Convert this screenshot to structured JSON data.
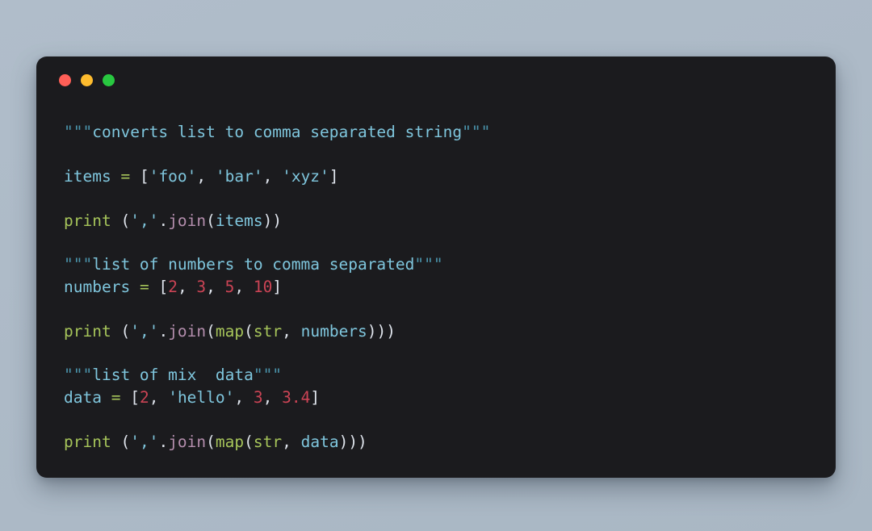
{
  "window": {
    "background_color": "#aebcc9",
    "panel_color": "#1b1b1e",
    "traffic_lights": [
      {
        "name": "close",
        "color": "#ff5f57"
      },
      {
        "name": "minimize",
        "color": "#febc2e"
      },
      {
        "name": "maximize",
        "color": "#28c840"
      }
    ]
  },
  "theme": {
    "plain": "#d8dee9",
    "punctuation": "#dfe4ec",
    "name": "#7fc6dd",
    "string": "#7fc6dd",
    "quote": "#4a93ab",
    "keyword": "#a6c45a",
    "builtin": "#a6c45a",
    "operator": "#a6c45a",
    "method": "#b48ead",
    "number": "#cc4455"
  },
  "code": {
    "language": "python",
    "plain_text": "\"\"\"converts list to comma separated string\"\"\"\n\nitems = ['foo', 'bar', 'xyz']\n\nprint (','.join(items))\n\n\"\"\"list of numbers to comma separated\"\"\"\nnumbers = [2, 3, 5, 10]\n\nprint (','.join(map(str, numbers)))\n\n\"\"\"list of mix  data\"\"\"\ndata = [2, 'hello', 3, 3.4]\n\nprint (','.join(map(str, data)))",
    "lines": [
      {
        "number": 1,
        "tokens": [
          {
            "t": "\"\"\"",
            "c": "quote"
          },
          {
            "t": "converts list to comma separated string",
            "c": "doc"
          },
          {
            "t": "\"\"\"",
            "c": "quote"
          }
        ]
      },
      {
        "number": 2,
        "tokens": []
      },
      {
        "number": 3,
        "tokens": [
          {
            "t": "items",
            "c": "name"
          },
          {
            "t": " ",
            "c": "plain"
          },
          {
            "t": "=",
            "c": "op"
          },
          {
            "t": " ",
            "c": "plain"
          },
          {
            "t": "[",
            "c": "punct"
          },
          {
            "t": "'foo'",
            "c": "string"
          },
          {
            "t": ", ",
            "c": "punct"
          },
          {
            "t": "'bar'",
            "c": "string"
          },
          {
            "t": ", ",
            "c": "punct"
          },
          {
            "t": "'xyz'",
            "c": "string"
          },
          {
            "t": "]",
            "c": "punct"
          }
        ]
      },
      {
        "number": 4,
        "tokens": []
      },
      {
        "number": 5,
        "tokens": [
          {
            "t": "print",
            "c": "kw"
          },
          {
            "t": " ",
            "c": "plain"
          },
          {
            "t": "(",
            "c": "punct"
          },
          {
            "t": "','",
            "c": "string"
          },
          {
            "t": ".",
            "c": "punct"
          },
          {
            "t": "join",
            "c": "method"
          },
          {
            "t": "(",
            "c": "punct"
          },
          {
            "t": "items",
            "c": "name"
          },
          {
            "t": "))",
            "c": "punct"
          }
        ]
      },
      {
        "number": 6,
        "tokens": []
      },
      {
        "number": 7,
        "tokens": [
          {
            "t": "\"\"\"",
            "c": "quote"
          },
          {
            "t": "list of numbers to comma separated",
            "c": "doc"
          },
          {
            "t": "\"\"\"",
            "c": "quote"
          }
        ]
      },
      {
        "number": 8,
        "tokens": [
          {
            "t": "numbers",
            "c": "name"
          },
          {
            "t": " ",
            "c": "plain"
          },
          {
            "t": "=",
            "c": "op"
          },
          {
            "t": " ",
            "c": "plain"
          },
          {
            "t": "[",
            "c": "punct"
          },
          {
            "t": "2",
            "c": "number"
          },
          {
            "t": ", ",
            "c": "punct"
          },
          {
            "t": "3",
            "c": "number"
          },
          {
            "t": ", ",
            "c": "punct"
          },
          {
            "t": "5",
            "c": "number"
          },
          {
            "t": ", ",
            "c": "punct"
          },
          {
            "t": "10",
            "c": "number"
          },
          {
            "t": "]",
            "c": "punct"
          }
        ]
      },
      {
        "number": 9,
        "tokens": []
      },
      {
        "number": 10,
        "tokens": [
          {
            "t": "print",
            "c": "kw"
          },
          {
            "t": " ",
            "c": "plain"
          },
          {
            "t": "(",
            "c": "punct"
          },
          {
            "t": "','",
            "c": "string"
          },
          {
            "t": ".",
            "c": "punct"
          },
          {
            "t": "join",
            "c": "method"
          },
          {
            "t": "(",
            "c": "punct"
          },
          {
            "t": "map",
            "c": "builtin"
          },
          {
            "t": "(",
            "c": "punct"
          },
          {
            "t": "str",
            "c": "builtin"
          },
          {
            "t": ", ",
            "c": "punct"
          },
          {
            "t": "numbers",
            "c": "name"
          },
          {
            "t": ")))",
            "c": "punct"
          }
        ]
      },
      {
        "number": 11,
        "tokens": []
      },
      {
        "number": 12,
        "tokens": [
          {
            "t": "\"\"\"",
            "c": "quote"
          },
          {
            "t": "list of mix  data",
            "c": "doc"
          },
          {
            "t": "\"\"\"",
            "c": "quote"
          }
        ]
      },
      {
        "number": 13,
        "tokens": [
          {
            "t": "data",
            "c": "name"
          },
          {
            "t": " ",
            "c": "plain"
          },
          {
            "t": "=",
            "c": "op"
          },
          {
            "t": " ",
            "c": "plain"
          },
          {
            "t": "[",
            "c": "punct"
          },
          {
            "t": "2",
            "c": "number"
          },
          {
            "t": ", ",
            "c": "punct"
          },
          {
            "t": "'hello'",
            "c": "string"
          },
          {
            "t": ", ",
            "c": "punct"
          },
          {
            "t": "3",
            "c": "number"
          },
          {
            "t": ", ",
            "c": "punct"
          },
          {
            "t": "3.4",
            "c": "number"
          },
          {
            "t": "]",
            "c": "punct"
          }
        ]
      },
      {
        "number": 14,
        "tokens": []
      },
      {
        "number": 15,
        "tokens": [
          {
            "t": "print",
            "c": "kw"
          },
          {
            "t": " ",
            "c": "plain"
          },
          {
            "t": "(",
            "c": "punct"
          },
          {
            "t": "','",
            "c": "string"
          },
          {
            "t": ".",
            "c": "punct"
          },
          {
            "t": "join",
            "c": "method"
          },
          {
            "t": "(",
            "c": "punct"
          },
          {
            "t": "map",
            "c": "builtin"
          },
          {
            "t": "(",
            "c": "punct"
          },
          {
            "t": "str",
            "c": "builtin"
          },
          {
            "t": ", ",
            "c": "punct"
          },
          {
            "t": "data",
            "c": "name"
          },
          {
            "t": ")))",
            "c": "punct"
          }
        ]
      }
    ]
  }
}
